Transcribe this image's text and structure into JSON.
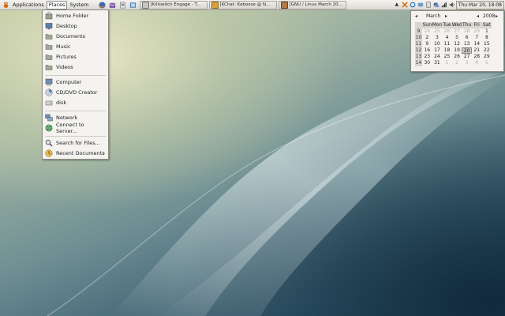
{
  "panel": {
    "applications": "Applications",
    "places": "Places",
    "system": "System",
    "tasks": [
      "[Killswitch Engage - T...",
      "[KChat: Kaboose @ N...",
      "[GNU / Linux March 20..."
    ],
    "clock": "Thu Mar 20, 18:08"
  },
  "places_menu": {
    "items": [
      {
        "label": "Home Folder",
        "icon": "home-folder-icon"
      },
      {
        "label": "Desktop",
        "icon": "desktop-icon"
      },
      {
        "label": "Documents",
        "icon": "folder-icon"
      },
      {
        "label": "Music",
        "icon": "folder-icon"
      },
      {
        "label": "Pictures",
        "icon": "folder-icon"
      },
      {
        "label": "Videos",
        "icon": "folder-icon"
      },
      {
        "label": "Computer",
        "icon": "computer-icon"
      },
      {
        "label": "CD/DVD Creator",
        "icon": "cd-icon"
      },
      {
        "label": "disk",
        "icon": "disk-icon"
      },
      {
        "label": "Network",
        "icon": "network-icon"
      },
      {
        "label": "Connect to Server...",
        "icon": "globe-icon"
      },
      {
        "label": "Search for Files...",
        "icon": "search-icon"
      },
      {
        "label": "Recent Documents",
        "icon": "recent-documents-icon",
        "arrow": "›"
      }
    ]
  },
  "calendar": {
    "month": "March",
    "year": "2008",
    "prev": "◂",
    "next": "▸",
    "day_headers": [
      "Sun",
      "Mon",
      "Tue",
      "Wed",
      "Thu",
      "Fri",
      "Sat"
    ],
    "weeks": [
      {
        "week": "9",
        "days": [
          "24",
          "25",
          "26",
          "27",
          "28",
          "29",
          "1"
        ]
      },
      {
        "week": "10",
        "days": [
          "2",
          "3",
          "4",
          "5",
          "6",
          "7",
          "8"
        ]
      },
      {
        "week": "11",
        "days": [
          "9",
          "10",
          "11",
          "12",
          "13",
          "14",
          "15"
        ]
      },
      {
        "week": "12",
        "days": [
          "16",
          "17",
          "18",
          "19",
          "20",
          "21",
          "22"
        ]
      },
      {
        "week": "13",
        "days": [
          "23",
          "24",
          "25",
          "26",
          "27",
          "28",
          "29"
        ]
      },
      {
        "week": "14",
        "days": [
          "30",
          "31",
          "1",
          "2",
          "3",
          "4",
          "5"
        ]
      }
    ],
    "selected_day": "20"
  }
}
